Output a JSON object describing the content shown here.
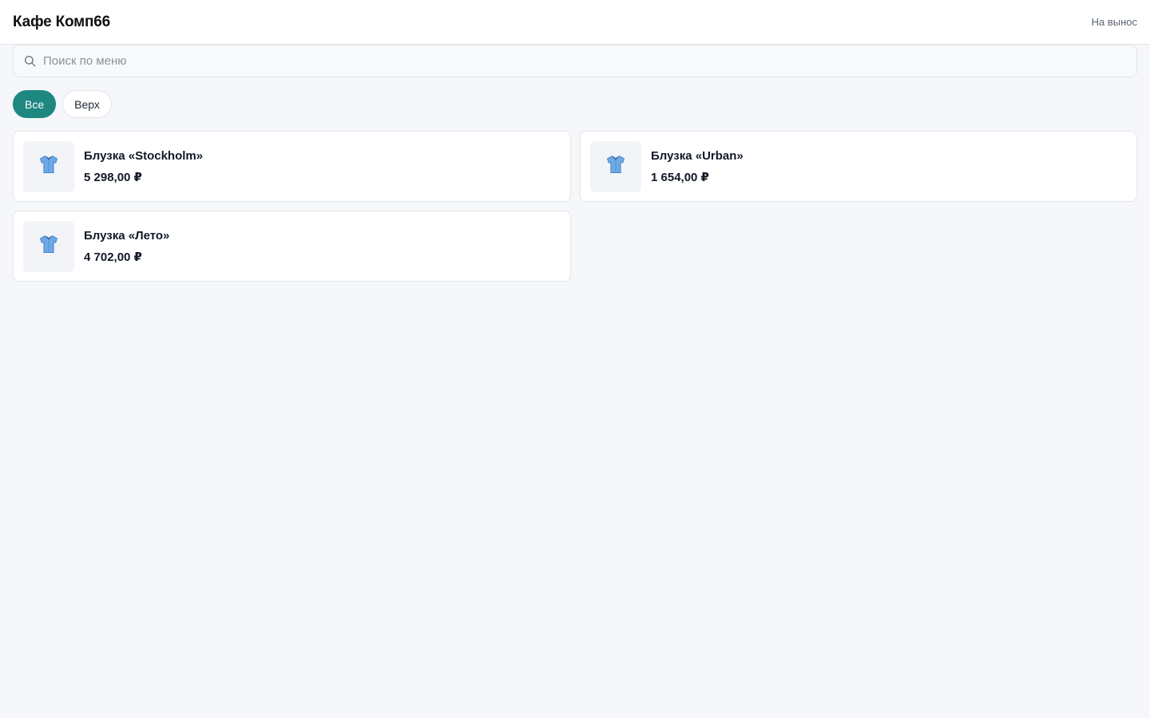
{
  "header": {
    "brand": "Кафе Комп66",
    "mode_link": "На вынос"
  },
  "search": {
    "placeholder": "Поиск по меню",
    "value": "",
    "icon": "search-icon"
  },
  "categories": [
    {
      "label": "Все",
      "active": true
    },
    {
      "label": "Верх",
      "active": false
    }
  ],
  "products": [
    {
      "name": "Блузка «Stockholm»",
      "price": "5 298,00 ₽",
      "icon": "shirt-icon"
    },
    {
      "name": "Блузка «Urban»",
      "price": "1 654,00 ₽",
      "icon": "shirt-icon"
    },
    {
      "name": "Блузка «Лето»",
      "price": "4 702,00 ₽",
      "icon": "shirt-icon"
    }
  ],
  "colors": {
    "accent": "#1d8780",
    "background": "#f5f7fa",
    "card": "#ffffff",
    "shirt": "#6ea8e6"
  }
}
